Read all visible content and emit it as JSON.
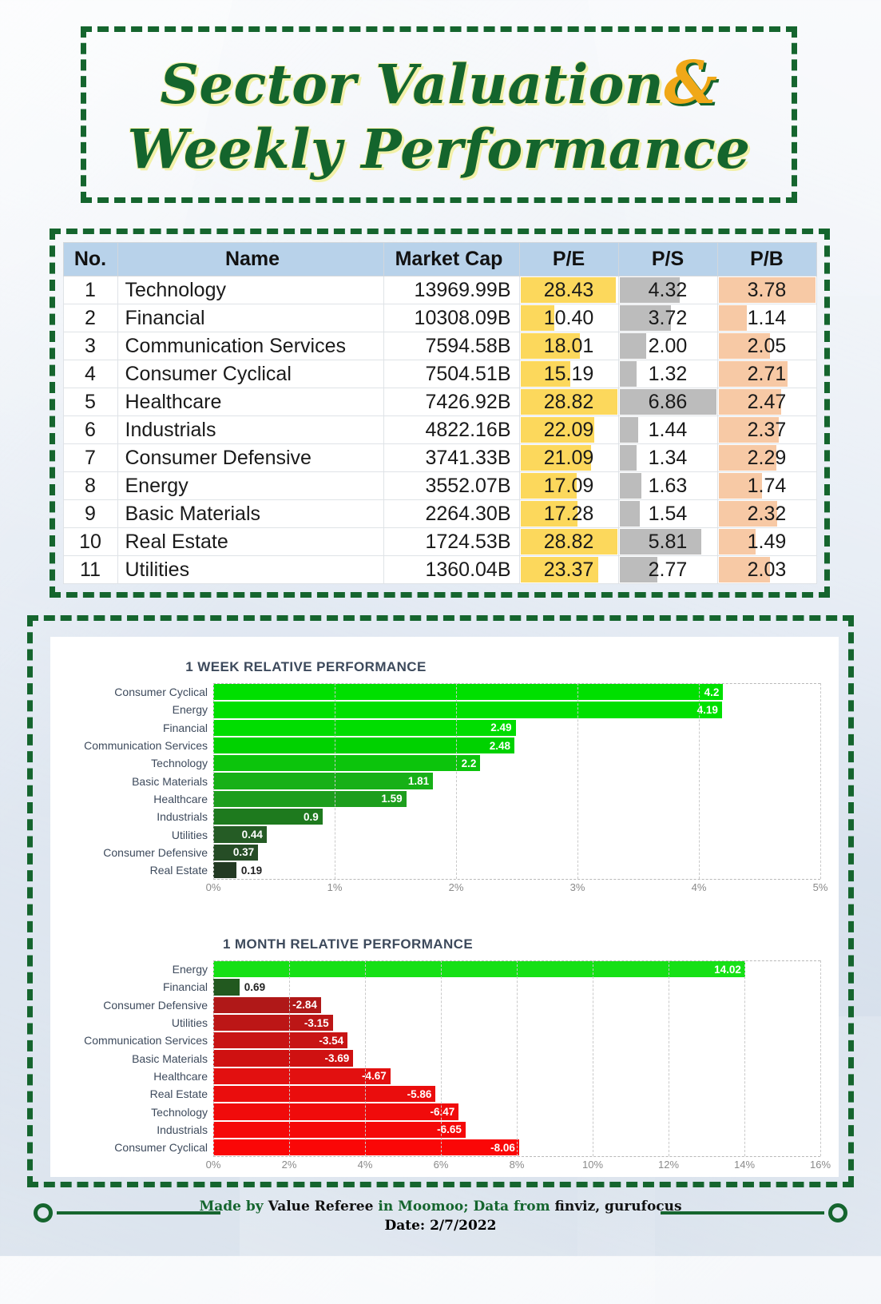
{
  "title": {
    "line1": "Sector Valuation",
    "amp": "&",
    "line2": "Weekly Performance"
  },
  "watermark": "Value Referee",
  "table": {
    "headers": [
      "No.",
      "Name",
      "Market Cap",
      "P/E",
      "P/S",
      "P/B"
    ],
    "rows": [
      {
        "no": "1",
        "name": "Technology",
        "cap": "13969.99B",
        "pe": "28.43",
        "ps": "4.32",
        "pb": "3.78"
      },
      {
        "no": "2",
        "name": "Financial",
        "cap": "10308.09B",
        "pe": "10.40",
        "ps": "3.72",
        "pb": "1.14"
      },
      {
        "no": "3",
        "name": "Communication Services",
        "cap": "7594.58B",
        "pe": "18.01",
        "ps": "2.00",
        "pb": "2.05"
      },
      {
        "no": "4",
        "name": "Consumer Cyclical",
        "cap": "7504.51B",
        "pe": "15.19",
        "ps": "1.32",
        "pb": "2.71"
      },
      {
        "no": "5",
        "name": "Healthcare",
        "cap": "7426.92B",
        "pe": "28.82",
        "ps": "6.86",
        "pb": "2.47"
      },
      {
        "no": "6",
        "name": "Industrials",
        "cap": "4822.16B",
        "pe": "22.09",
        "ps": "1.44",
        "pb": "2.37"
      },
      {
        "no": "7",
        "name": "Consumer Defensive",
        "cap": "3741.33B",
        "pe": "21.09",
        "ps": "1.34",
        "pb": "2.29"
      },
      {
        "no": "8",
        "name": "Energy",
        "cap": "3552.07B",
        "pe": "17.09",
        "ps": "1.63",
        "pb": "1.74"
      },
      {
        "no": "9",
        "name": "Basic Materials",
        "cap": "2264.30B",
        "pe": "17.28",
        "ps": "1.54",
        "pb": "2.32"
      },
      {
        "no": "10",
        "name": "Real Estate",
        "cap": "1724.53B",
        "pe": "28.82",
        "ps": "5.81",
        "pb": "1.49"
      },
      {
        "no": "11",
        "name": "Utilities",
        "cap": "1360.04B",
        "pe": "23.37",
        "ps": "2.77",
        "pb": "2.03"
      }
    ],
    "colors": {
      "header_bg": "#b8d2ea",
      "pe_bar": "#fcd85c",
      "ps_bar": "#bcbcbc",
      "pb_bar": "#f7c9a5"
    }
  },
  "chart_data": [
    {
      "type": "bar",
      "orientation": "horizontal",
      "title": "1 WEEK RELATIVE PERFORMANCE",
      "categories": [
        "Consumer Cyclical",
        "Energy",
        "Financial",
        "Communication Services",
        "Technology",
        "Basic Materials",
        "Healthcare",
        "Industrials",
        "Utilities",
        "Consumer Defensive",
        "Real Estate"
      ],
      "values": [
        4.2,
        4.19,
        2.49,
        2.48,
        2.2,
        1.81,
        1.59,
        0.9,
        0.44,
        0.37,
        0.19
      ],
      "labels": [
        "4.2",
        "4.19",
        "2.49",
        "2.48",
        "2.2",
        "1.81",
        "1.59",
        "0.9",
        "0.44",
        "0.37",
        "0.19"
      ],
      "bar_colors": [
        "#00e000",
        "#00e000",
        "#00dd00",
        "#00d200",
        "#0cc40c",
        "#17b017",
        "#1d9e1d",
        "#1e7a1e",
        "#255c25",
        "#264d26",
        "#233a23"
      ],
      "xlabel": "",
      "ylabel": "",
      "xticks": [
        "0%",
        "1%",
        "2%",
        "3%",
        "4%",
        "5%"
      ],
      "xlim": [
        0,
        5
      ],
      "grid": true
    },
    {
      "type": "bar",
      "orientation": "horizontal",
      "title": "1 MONTH RELATIVE PERFORMANCE",
      "categories": [
        "Energy",
        "Financial",
        "Consumer Defensive",
        "Utilities",
        "Communication Services",
        "Basic Materials",
        "Healthcare",
        "Real Estate",
        "Technology",
        "Industrials",
        "Consumer Cyclical"
      ],
      "values": [
        14.02,
        0.69,
        -2.84,
        -3.15,
        -3.54,
        -3.69,
        -4.67,
        -5.86,
        -6.47,
        -6.65,
        -8.06
      ],
      "labels": [
        "14.02",
        "0.69",
        "-2.84",
        "-3.15",
        "-3.54",
        "-3.69",
        "-4.67",
        "-5.86",
        "-6.47",
        "-6.65",
        "-8.06"
      ],
      "bar_colors": [
        "#16e016",
        "#22591f",
        "#b01818",
        "#bc1616",
        "#c81414",
        "#cf1111",
        "#e21010",
        "#ea0d0d",
        "#f00b0b",
        "#f50909",
        "#fa0707"
      ],
      "xlabel": "",
      "ylabel": "",
      "xticks": [
        "0%",
        "2%",
        "4%",
        "6%",
        "8%",
        "10%",
        "12%",
        "14%",
        "16%"
      ],
      "xlim": [
        0,
        16
      ],
      "grid": true
    }
  ],
  "footer": {
    "made_by_prefix": "Made by ",
    "brand": "Value Referee",
    "middle": " in Moomoo; Data from ",
    "sources": "finviz, gurufocus",
    "date": "Date: 2/7/2022"
  }
}
